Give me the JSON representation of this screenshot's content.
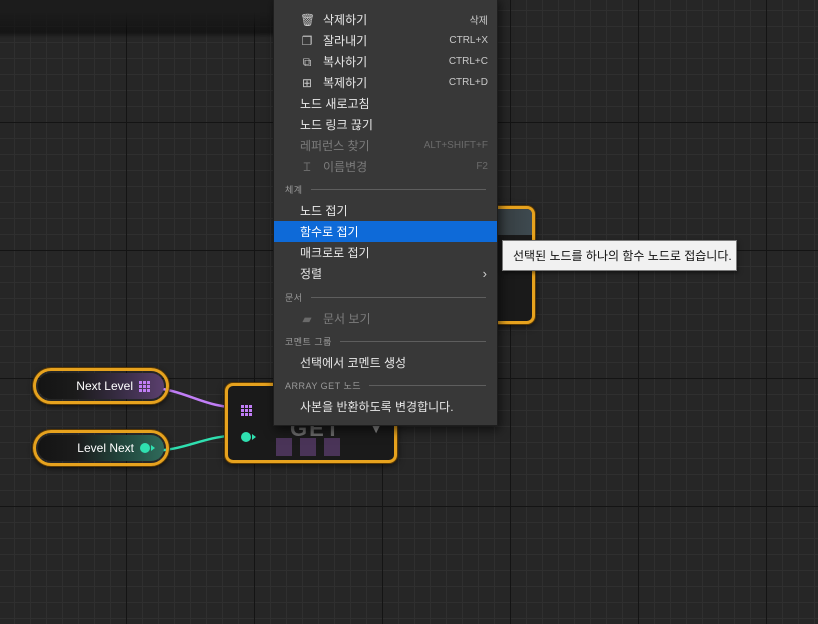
{
  "nodes": {
    "next_level": {
      "label": "Next Level"
    },
    "level_next": {
      "label": "Level Next"
    },
    "get": {
      "title": "GET"
    }
  },
  "context_menu": {
    "top_items": [
      {
        "label": "삭제하기",
        "shortcut": "삭제",
        "icon": "trash-icon",
        "enabled": true
      },
      {
        "label": "잘라내기",
        "shortcut": "CTRL+X",
        "icon": "cut-icon",
        "enabled": true
      },
      {
        "label": "복사하기",
        "shortcut": "CTRL+C",
        "icon": "copy-icon",
        "enabled": true
      },
      {
        "label": "복제하기",
        "shortcut": "CTRL+D",
        "icon": "duplicate-icon",
        "enabled": true
      },
      {
        "label": "노드 새로고침",
        "shortcut": "",
        "enabled": true
      },
      {
        "label": "노드 링크 끊기",
        "shortcut": "",
        "enabled": true
      },
      {
        "label": "레퍼런스 찾기",
        "shortcut": "ALT+SHIFT+F",
        "enabled": false
      },
      {
        "label": "이름변경",
        "shortcut": "F2",
        "icon": "rename-icon",
        "enabled": false
      }
    ],
    "section_organization": "체계",
    "organization_items": [
      {
        "label": "노드 접기",
        "enabled": true
      },
      {
        "label": "함수로 접기",
        "enabled": true,
        "highlighted": true
      },
      {
        "label": "매크로로 접기",
        "enabled": true
      },
      {
        "label": "정렬",
        "enabled": true,
        "submenu": true
      }
    ],
    "section_documentation": "문서",
    "documentation_items": [
      {
        "label": "문서 보기",
        "icon": "document-icon",
        "enabled": false
      }
    ],
    "section_comment_group": "코멘트 그룹",
    "comment_items": [
      {
        "label": "선택에서 코멘트 생성",
        "enabled": true
      }
    ],
    "section_array_get": "ARRAY GET 노드",
    "array_get_items": [
      {
        "label": "사본을 반환하도록 변경합니다.",
        "enabled": true
      }
    ]
  },
  "tooltip": {
    "text": "선택된 노드를 하나의 함수 노드로 접습니다."
  },
  "colors": {
    "selection_outline": "#e6a21e",
    "array_pin": "#c17ef7",
    "integer_pin": "#2fe0b0",
    "menu_highlight": "#0e6ad8"
  }
}
